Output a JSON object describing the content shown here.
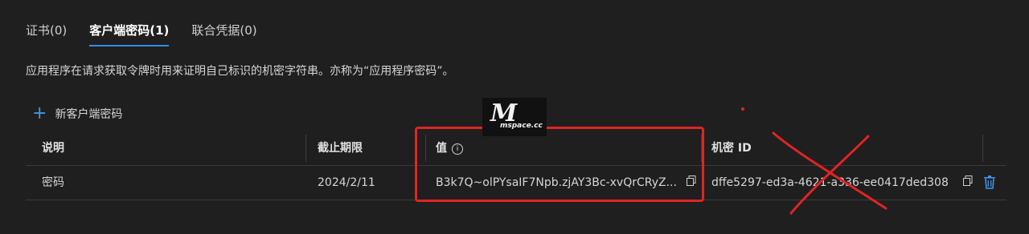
{
  "tabs": [
    {
      "label": "证书(0)"
    },
    {
      "label": "客户端密码(1)"
    },
    {
      "label": "联合凭据(0)"
    }
  ],
  "description": "应用程序在请求获取令牌时用来证明自己标识的机密字符串。亦称为“应用程序密码”。",
  "new_secret_label": "新客户端密码",
  "table": {
    "headers": [
      "说明",
      "截止期限",
      "值",
      "机密 ID"
    ],
    "rows": [
      {
        "description": "密码",
        "expires": "2024/2/11",
        "value": "B3k7Q~olPYsaIF7Npb.zjAY3Bc-xvQrCRyZ...",
        "secret_id": "dffe5297-ed3a-4621-a336-ee0417ded308"
      }
    ]
  },
  "watermark": {
    "big": "M",
    "small": "mspace.cc"
  },
  "colors": {
    "accent": "#2f8fe8",
    "annotation": "#e02424",
    "background": "#1f1f1f"
  }
}
